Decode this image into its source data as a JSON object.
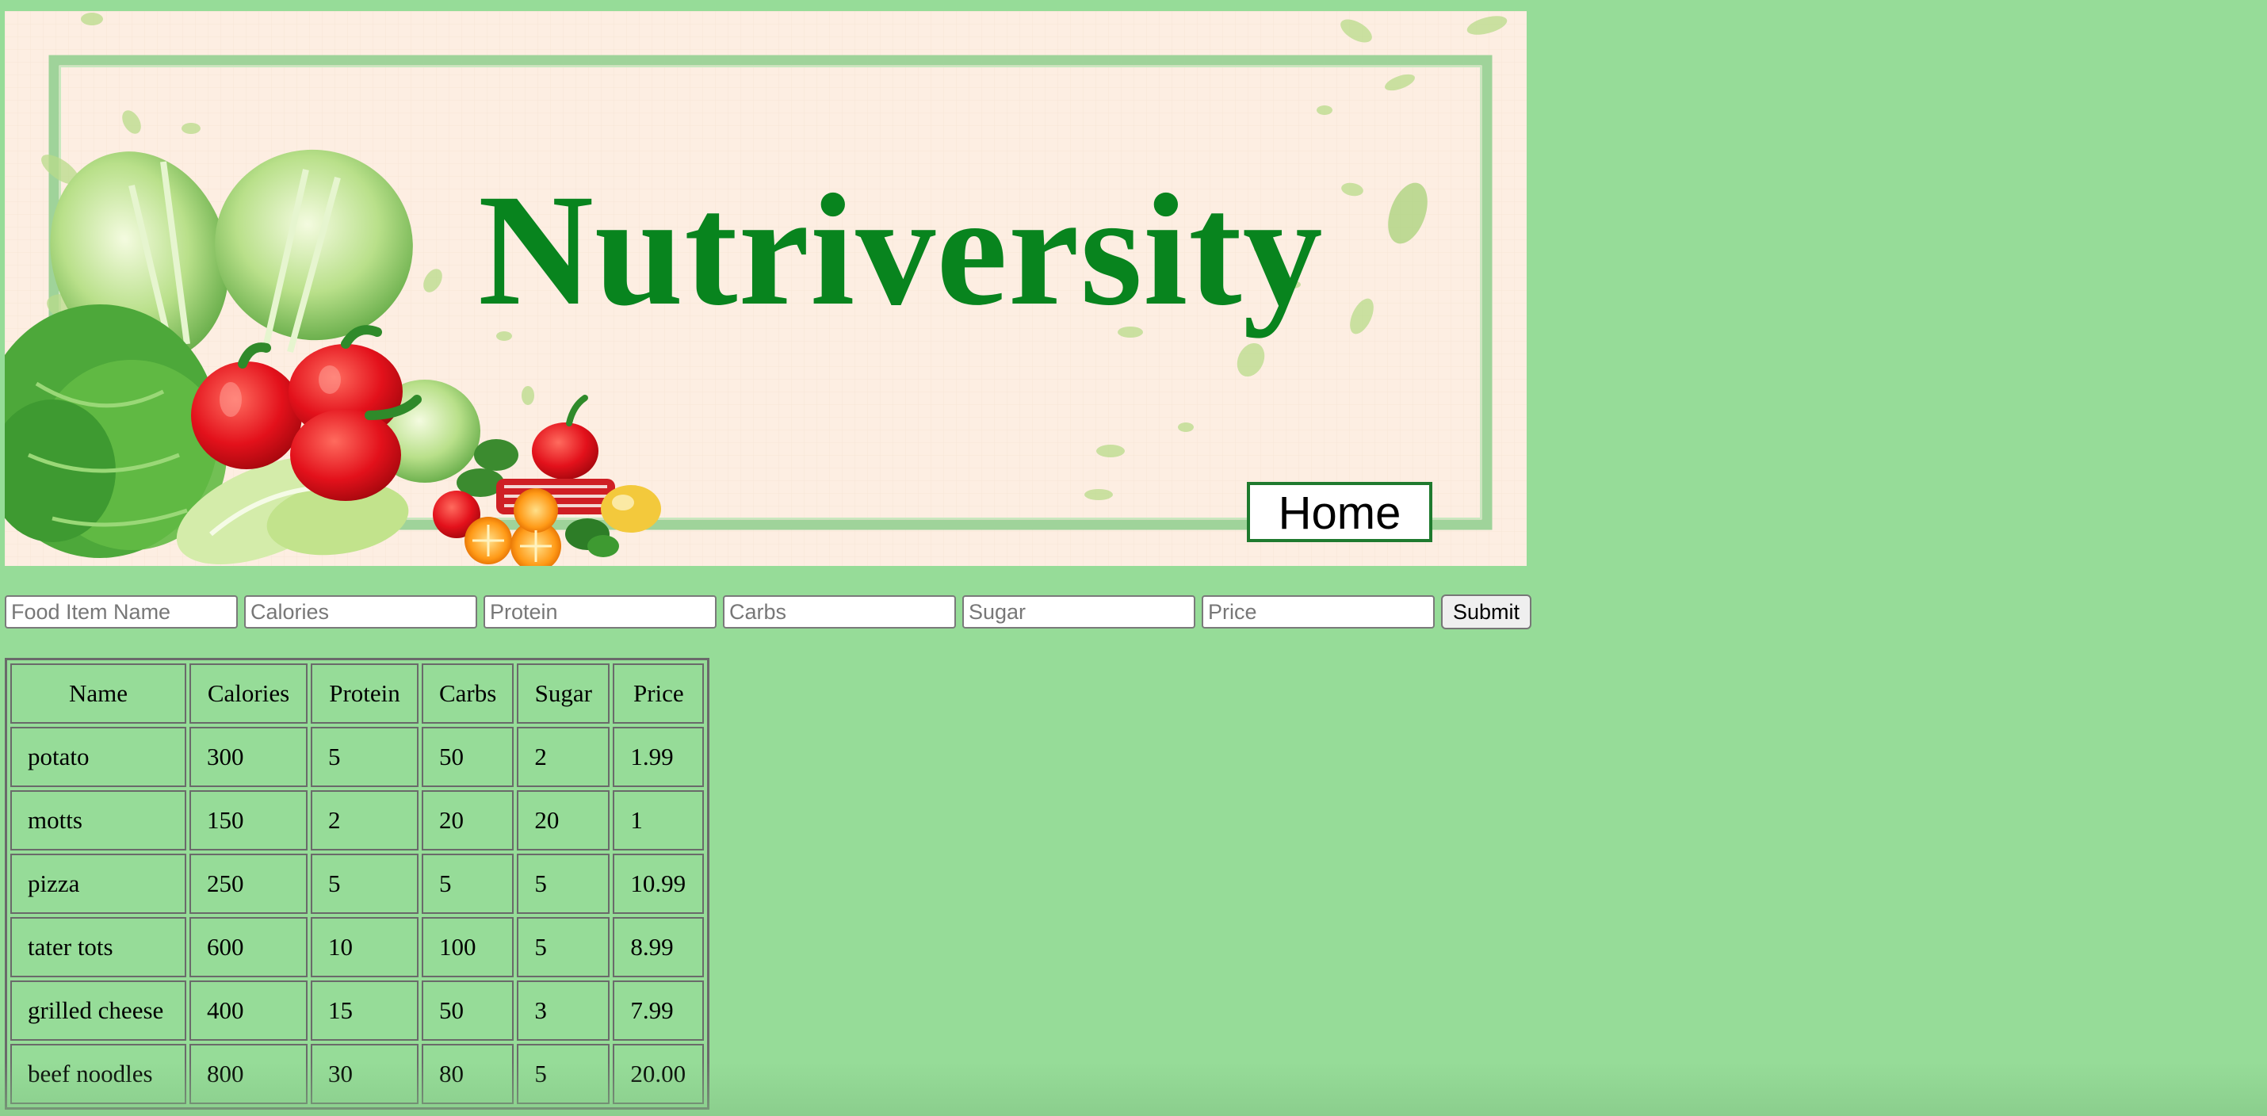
{
  "banner": {
    "title": "Nutriversity",
    "home_label": "Home"
  },
  "form": {
    "placeholders": {
      "name": "Food Item Name",
      "calories": "Calories",
      "protein": "Protein",
      "carbs": "Carbs",
      "sugar": "Sugar",
      "price": "Price"
    },
    "submit_label": "Submit"
  },
  "table": {
    "headers": [
      "Name",
      "Calories",
      "Protein",
      "Carbs",
      "Sugar",
      "Price"
    ],
    "rows": [
      [
        "potato",
        "300",
        "5",
        "50",
        "2",
        "1.99"
      ],
      [
        "motts",
        "150",
        "2",
        "20",
        "20",
        "1"
      ],
      [
        "pizza",
        "250",
        "5",
        "5",
        "5",
        "10.99"
      ],
      [
        "tater tots",
        "600",
        "10",
        "100",
        "5",
        "8.99"
      ],
      [
        "grilled cheese",
        "400",
        "15",
        "50",
        "3",
        "7.99"
      ],
      [
        "beef noodles",
        "800",
        "30",
        "80",
        "5",
        "20.00"
      ]
    ]
  },
  "colors": {
    "page_background": "#96dc98",
    "title": "#08841e",
    "banner_background": "#fdeee2",
    "frame": "#9fd39a"
  }
}
